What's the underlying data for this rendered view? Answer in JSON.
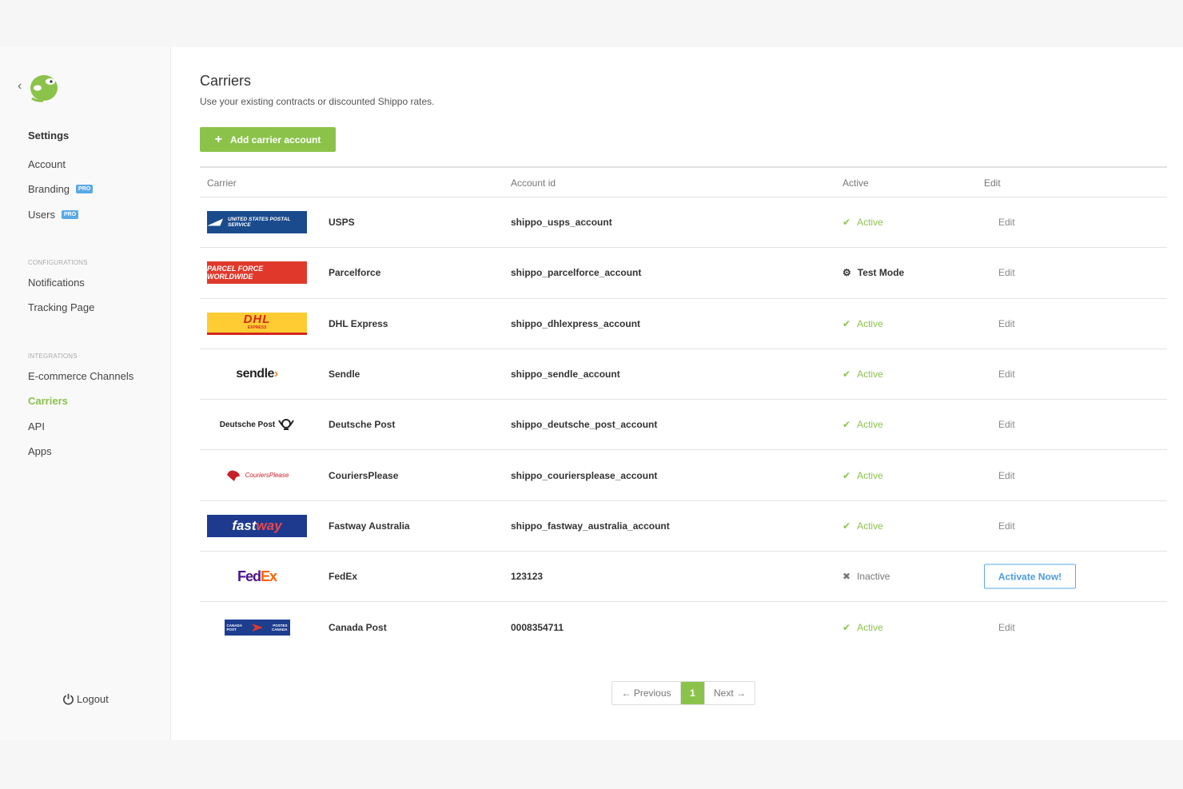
{
  "sidebar": {
    "back_icon": "chevron-left-icon",
    "logo_icon": "shippo-logo-icon",
    "settings_title": "Settings",
    "items_settings": [
      {
        "label": "Account"
      },
      {
        "label": "Branding",
        "badge": "PRO"
      },
      {
        "label": "Users",
        "badge": "PRO"
      }
    ],
    "section_configurations": "CONFIGURATIONS",
    "items_configurations": [
      {
        "label": "Notifications"
      },
      {
        "label": "Tracking Page"
      }
    ],
    "section_integrations": "INTEGRATIONS",
    "items_integrations": [
      {
        "label": "E-commerce Channels"
      },
      {
        "label": "Carriers",
        "active": true
      },
      {
        "label": "API"
      },
      {
        "label": "Apps"
      }
    ],
    "logout_label": "Logout"
  },
  "main": {
    "title": "Carriers",
    "subtitle": "Use your existing contracts or discounted Shippo rates.",
    "add_button_label": "Add carrier account",
    "table": {
      "headers": {
        "carrier": "Carrier",
        "account_id": "Account id",
        "active": "Active",
        "edit": "Edit"
      },
      "rows": [
        {
          "logo": "usps",
          "logo_text": "UNITED STATES POSTAL SERVICE",
          "name": "USPS",
          "account_id": "shippo_usps_account",
          "status": "Active",
          "status_type": "active",
          "edit": "Edit"
        },
        {
          "logo": "parcelforce",
          "logo_text": "PARCEL FORCE WORLDWIDE",
          "name": "Parcelforce",
          "account_id": "shippo_parcelforce_account",
          "status": "Test Mode",
          "status_type": "test",
          "edit": "Edit"
        },
        {
          "logo": "dhl",
          "logo_text": "DHL",
          "logo_sub": "EXPRESS",
          "name": "DHL Express",
          "account_id": "shippo_dhlexpress_account",
          "status": "Active",
          "status_type": "active",
          "edit": "Edit"
        },
        {
          "logo": "sendle",
          "logo_text": "sendle",
          "name": "Sendle",
          "account_id": "shippo_sendle_account",
          "status": "Active",
          "status_type": "active",
          "edit": "Edit"
        },
        {
          "logo": "deutschepost",
          "logo_text": "Deutsche Post",
          "name": "Deutsche Post",
          "account_id": "shippo_deutsche_post_account",
          "status": "Active",
          "status_type": "active",
          "edit": "Edit"
        },
        {
          "logo": "couriersplease",
          "logo_text": "CouriersPlease",
          "name": "CouriersPlease",
          "account_id": "shippo_couriersplease_account",
          "status": "Active",
          "status_type": "active",
          "edit": "Edit"
        },
        {
          "logo": "fastway",
          "logo_text": "fast",
          "logo_text2": "way",
          "name": "Fastway Australia",
          "account_id": "shippo_fastway_australia_account",
          "status": "Active",
          "status_type": "active",
          "edit": "Edit"
        },
        {
          "logo": "fedex",
          "logo_text": "Fed",
          "logo_text2": "Ex",
          "name": "FedEx",
          "account_id": "123123",
          "status": "Inactive",
          "status_type": "inactive",
          "action": "Activate Now!"
        },
        {
          "logo": "canadapost",
          "logo_text": "CANADA POST",
          "logo_text2": "POSTES CANADA",
          "name": "Canada Post",
          "account_id": "0008354711",
          "status": "Active",
          "status_type": "active",
          "edit": "Edit"
        }
      ]
    },
    "pagination": {
      "previous": "← Previous",
      "current": "1",
      "next": "Next →"
    }
  },
  "colors": {
    "accent": "#8bc34a",
    "link_blue": "#4a9cdc",
    "pro_badge": "#5aa9e6"
  }
}
